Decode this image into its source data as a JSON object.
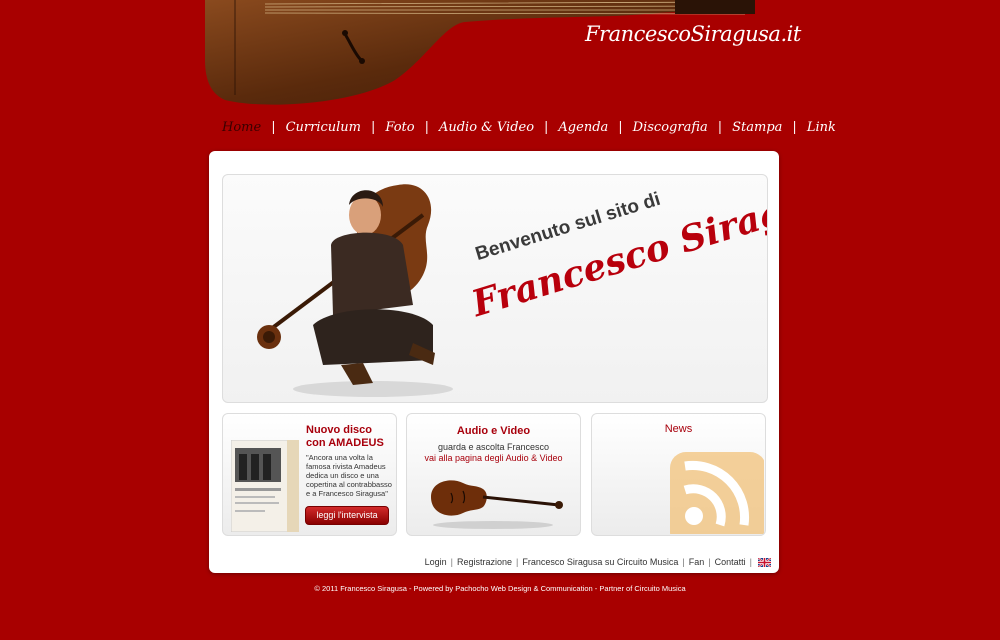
{
  "site": {
    "title": "FrancescoSiragusa.it"
  },
  "nav": {
    "items": [
      {
        "label": "Home"
      },
      {
        "label": "Curriculum"
      },
      {
        "label": "Foto"
      },
      {
        "label": "Audio & Video"
      },
      {
        "label": "Agenda"
      },
      {
        "label": "Discografia"
      },
      {
        "label": "Stampa"
      },
      {
        "label": "Link"
      }
    ],
    "separator": "|"
  },
  "hero": {
    "line1": "Benvenuto sul sito di",
    "line2": "Francesco Siragusa"
  },
  "box1": {
    "title": "Nuovo disco con AMADEUS",
    "quote": "\"Ancora una volta la famosa rivista Amadeus dedica un disco e una copertina al contrabbasso e a Francesco Siragusa\"",
    "button": "leggi l'intervista"
  },
  "box2": {
    "title": "Audio e Video",
    "line1": "guarda e ascolta Francesco",
    "line2": "vai alla pagina degli Audio & Video"
  },
  "box3": {
    "title": "News"
  },
  "footer": {
    "links": [
      {
        "label": "Login"
      },
      {
        "label": "Registrazione"
      },
      {
        "label": "Francesco Siragusa su Circuito Musica"
      },
      {
        "label": "Fan"
      },
      {
        "label": "Contatti"
      }
    ],
    "separator": "|",
    "copyright": "© 2011 Francesco Siragusa - Powered by Pachocho Web Design & Communication - Partner of Circuito Musica"
  },
  "colors": {
    "background": "#a80000",
    "accent": "#a8000c",
    "panel": "#ffffff"
  },
  "icons": {
    "flag": "uk-flag-icon",
    "rss": "rss-icon"
  }
}
